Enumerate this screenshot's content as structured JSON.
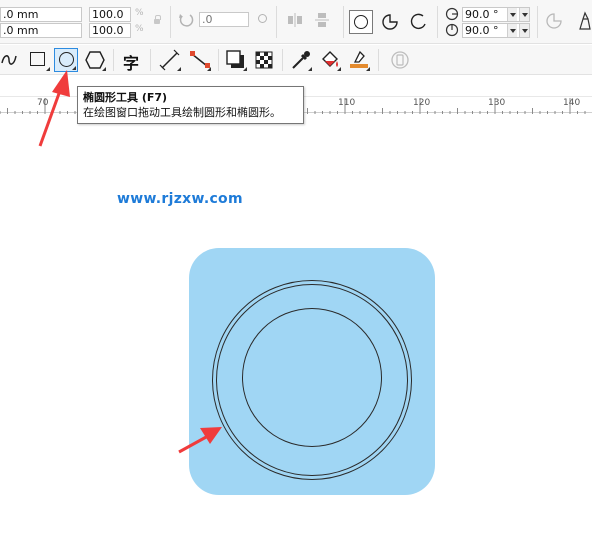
{
  "property_bar": {
    "pos_x": ".0 mm",
    "pos_y": ".0 mm",
    "scale_x": "100.0",
    "scale_y": "100.0",
    "scale_unit": "%",
    "rotation": ".0",
    "start_angle": "90.0 °",
    "end_angle": "90.0 °"
  },
  "toolbar": {
    "text_tool_glyph": "字",
    "active_tool": "ellipse-tool"
  },
  "tooltip": {
    "title": "椭圆形工具 (F7)",
    "description": "在绘图窗口拖动工具绘制圆形和椭圆形。"
  },
  "ruler": {
    "labels": [
      "70",
      "110",
      "120",
      "130",
      "140"
    ]
  },
  "watermark": {
    "text": "www.rjzxw.com"
  },
  "colors": {
    "background_shape": "#a0d6f4",
    "annotation_arrow": "#f03c3c",
    "active_tool_border": "#2c8be0",
    "watermark": "#1e7bd8"
  }
}
